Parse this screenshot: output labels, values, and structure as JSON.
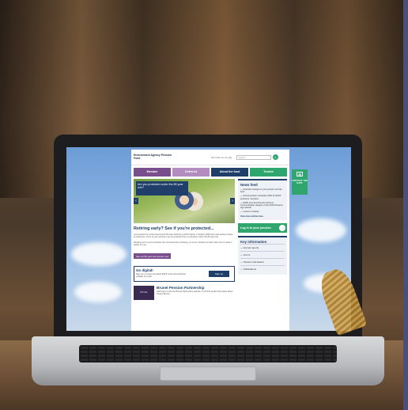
{
  "header": {
    "logo_text": "Environment Agency Pension Fund",
    "text_size_label": "Text size: A+ A+ [A]",
    "search_placeholder": "Search"
  },
  "nav": {
    "member": "Member",
    "deferred": "Deferred",
    "about": "About the fund",
    "trustee": "Trustee"
  },
  "hero": {
    "title": "Are you protected under the 85 year rule?",
    "left_arrow": "‹",
    "right_arrow": "›"
  },
  "main": {
    "heading": "Retiring early? See if you're protected...",
    "para1": "If you joined the Local Government Pension Scheme (LGPS) before 1 October 2006 and meet certain criteria at retirement, some of your pension may be protected from a reduction under the 85 year rule.",
    "para2": "Working out if you're protected can sometimes be confusing, so we've created a simple online tool to make it easier for you.",
    "pill": "See our 85 year rule checker tool"
  },
  "digital": {
    "title": "Go digital!",
    "sub": "Sign up to receive the latest EAPF news and important updates by email.",
    "button": "Sign up"
  },
  "brunel": {
    "logo": "BRUNEL",
    "title": "Brunel Pension Partnership",
    "text": "Click here to visit the Brunel Partnership website. You'll find useful information about Project Brunel."
  },
  "news": {
    "title": "News feed",
    "items": [
      "— Important changes to your pension and the fund",
      "— Annual pension newsletter 2016 for EAPF pensioner members",
      "— EAPF wins best Pension Scheme Communication category at the 2016 Pensions Age awards",
      "— Lecture on Equity"
    ],
    "more": "View more articles here"
  },
  "login": {
    "label": "Log in to your pension",
    "icon": "→"
  },
  "keyinfo": {
    "title": "Key information",
    "items": [
      "— Annual reports",
      "— Forms",
      "— Pension calculators",
      "— Publications"
    ]
  },
  "contact": {
    "label": "CONTACT THE EAPF",
    "icon": "✉"
  }
}
